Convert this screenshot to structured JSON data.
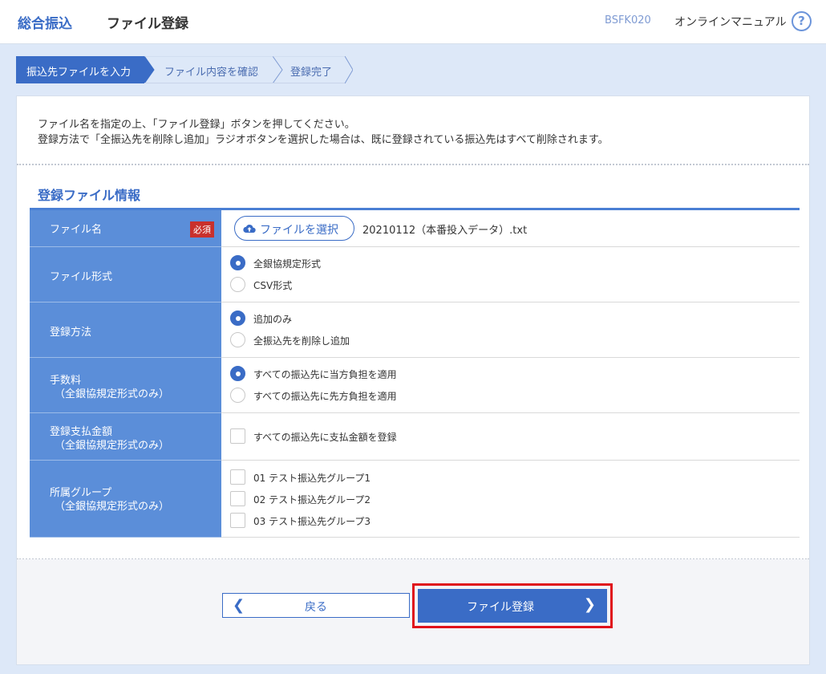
{
  "header": {
    "service_name": "総合振込",
    "page_title": "ファイル登録",
    "screen_code": "BSFK020",
    "manual_link": "オンラインマニュアル",
    "help_icon": "?"
  },
  "steps": [
    {
      "label": "振込先ファイルを入力",
      "active": true
    },
    {
      "label": "ファイル内容を確認",
      "active": false
    },
    {
      "label": "登録完了",
      "active": false
    }
  ],
  "intro": {
    "line1": "ファイル名を指定の上、「ファイル登録」ボタンを押してください。",
    "line2": "登録方法で「全振込先を削除し追加」ラジオボタンを選択した場合は、既に登録されている振込先はすべて削除されます。"
  },
  "section_title": "登録ファイル情報",
  "form": {
    "file_name": {
      "label": "ファイル名",
      "required_badge": "必須",
      "select_button": "ファイルを選択",
      "selected_file": "20210112（本番投入データ）.txt"
    },
    "file_format": {
      "label": "ファイル形式",
      "options": [
        "全銀協規定形式",
        "CSV形式"
      ],
      "selected": "全銀協規定形式"
    },
    "register_method": {
      "label": "登録方法",
      "options": [
        "追加のみ",
        "全振込先を削除し追加"
      ],
      "selected": "追加のみ"
    },
    "fee": {
      "label_line1": "手数料",
      "label_line2": "（全銀協規定形式のみ）",
      "options": [
        "すべての振込先に当方負担を適用",
        "すべての振込先に先方負担を適用"
      ],
      "selected": "すべての振込先に当方負担を適用"
    },
    "payment_amount": {
      "label_line1": "登録支払金額",
      "label_line2": "（全銀協規定形式のみ）",
      "checkbox": "すべての振込先に支払金額を登録",
      "checked": false
    },
    "group": {
      "label_line1": "所属グループ",
      "label_line2": "（全銀協規定形式のみ）",
      "options": [
        "01 テスト振込先グループ1",
        "02 テスト振込先グループ2",
        "03 テスト振込先グループ3"
      ]
    }
  },
  "buttons": {
    "back": "戻る",
    "register": "ファイル登録"
  },
  "colors": {
    "accent": "#3a6cc6",
    "label_bg": "#5b8ed9",
    "page_bg": "#dde8f8",
    "highlight": "#e0121b"
  }
}
